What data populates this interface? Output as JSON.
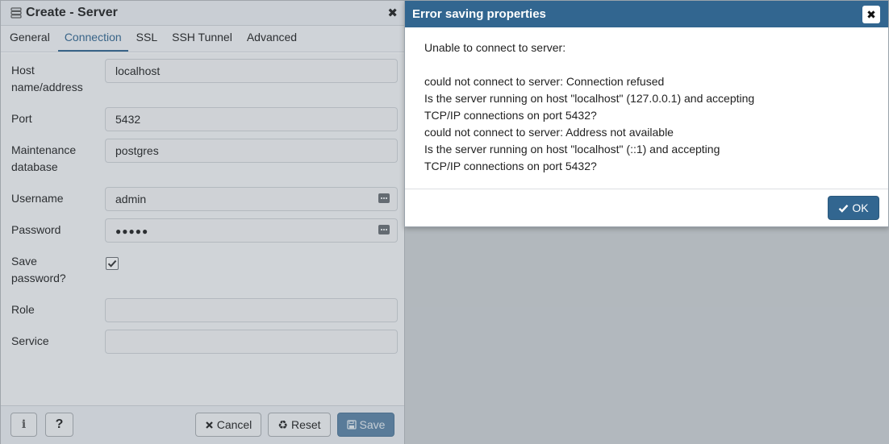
{
  "server_dialog": {
    "title": "Create - Server",
    "close_glyph": "✖",
    "tabs": [
      {
        "label": "General",
        "active": false
      },
      {
        "label": "Connection",
        "active": true
      },
      {
        "label": "SSL",
        "active": false
      },
      {
        "label": "SSH Tunnel",
        "active": false
      },
      {
        "label": "Advanced",
        "active": false
      }
    ],
    "fields": {
      "host": {
        "label": "Host name/address",
        "value": "localhost"
      },
      "port": {
        "label": "Port",
        "value": "5432"
      },
      "maintenance_db": {
        "label": "Maintenance database",
        "value": "postgres"
      },
      "username": {
        "label": "Username",
        "value": "admin"
      },
      "password": {
        "label": "Password",
        "value": "●●●●●"
      },
      "save_password": {
        "label": "Save password?",
        "checked": true
      },
      "role": {
        "label": "Role",
        "value": ""
      },
      "service": {
        "label": "Service",
        "value": ""
      }
    },
    "footer": {
      "info_icon": "i",
      "help_label": "?",
      "cancel_label": "Cancel",
      "reset_label": "Reset",
      "save_label": "Save"
    }
  },
  "error_dialog": {
    "title": "Error saving properties",
    "close_glyph": "✖",
    "intro": "Unable to connect to server:",
    "lines": [
      "could not connect to server: Connection refused",
      "Is the server running on host \"localhost\" (127.0.0.1) and accepting",
      "TCP/IP connections on port 5432?",
      "could not connect to server: Address not available",
      "Is the server running on host \"localhost\" (::1) and accepting",
      "TCP/IP connections on port 5432?"
    ],
    "ok_label": "OK"
  },
  "colors": {
    "accent": "#326690",
    "backdrop": "#ced1d4"
  },
  "icons": {
    "server": "server-icon",
    "close": "close-icon",
    "field": "ellipsis-field-icon",
    "check": "check-icon",
    "info": "info-icon",
    "help": "question-icon",
    "cancel": "x-icon",
    "reset": "recycle-icon",
    "save": "floppy-icon"
  }
}
